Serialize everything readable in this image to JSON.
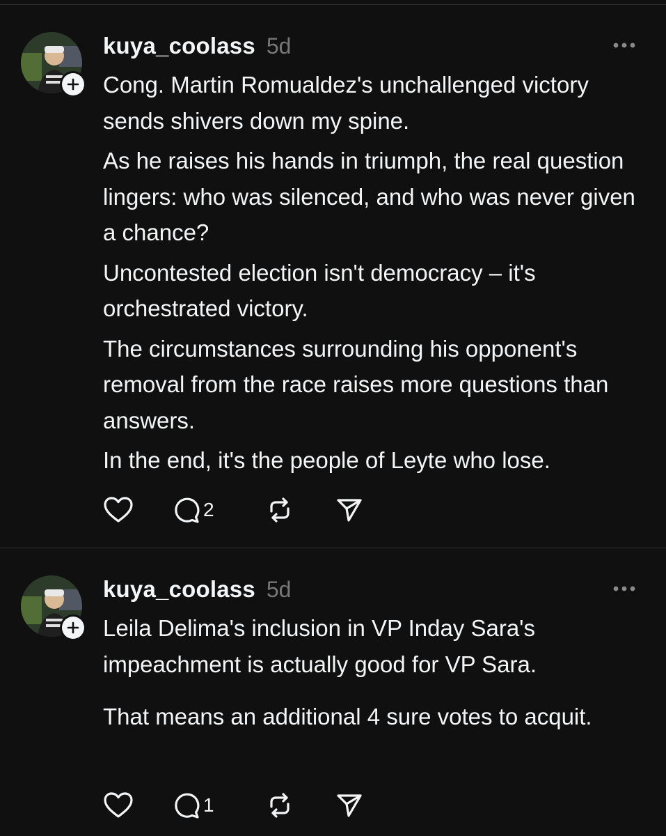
{
  "posts": [
    {
      "username": "kuya_coolass",
      "timestamp": "5d",
      "paragraphs": [
        "Cong. Martin Romualdez's unchallenged victory sends shivers down my spine.",
        "As he raises his hands in triumph, the real question lingers: who was silenced, and who was never given a chance?",
        "Uncontested election isn't democracy – it's orchestrated victory.",
        "The circumstances surrounding his opponent's removal from the race raises more questions than answers.",
        "In the end, it's the people of Leyte who lose."
      ],
      "reply_count": "2"
    },
    {
      "username": "kuya_coolass",
      "timestamp": "5d",
      "paragraphs": [
        "Leila Delima's inclusion in VP Inday Sara's impeachment is actually good for VP Sara.",
        "That means an additional 4 sure votes to acquit."
      ],
      "reply_count": "1"
    }
  ],
  "icons": {
    "avatar": "avatar-photo",
    "follow": "plus-icon",
    "more": "more-horizontal-icon",
    "like": "heart-icon",
    "reply": "comment-bubble-icon",
    "repost": "repost-icon",
    "share": "send-icon"
  },
  "colors": {
    "background": "#101010",
    "text": "#f3f5f7",
    "secondary_text": "#777777",
    "divider": "#2e2e2e"
  }
}
